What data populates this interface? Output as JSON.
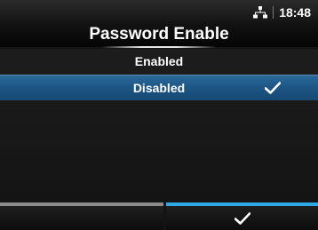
{
  "header": {
    "title": "Password Enable",
    "time": "18:48",
    "network_icon": "lan-network-icon"
  },
  "options": [
    {
      "label": "Enabled",
      "selected": false
    },
    {
      "label": "Disabled",
      "selected": true
    }
  ],
  "footer": {
    "back_button": {
      "icon": "back-bar",
      "active": false
    },
    "confirm_button": {
      "icon": "check-icon",
      "active": true
    }
  },
  "colors": {
    "selection": "#1d5584",
    "accent": "#2fa8e8",
    "background": "#141414"
  }
}
